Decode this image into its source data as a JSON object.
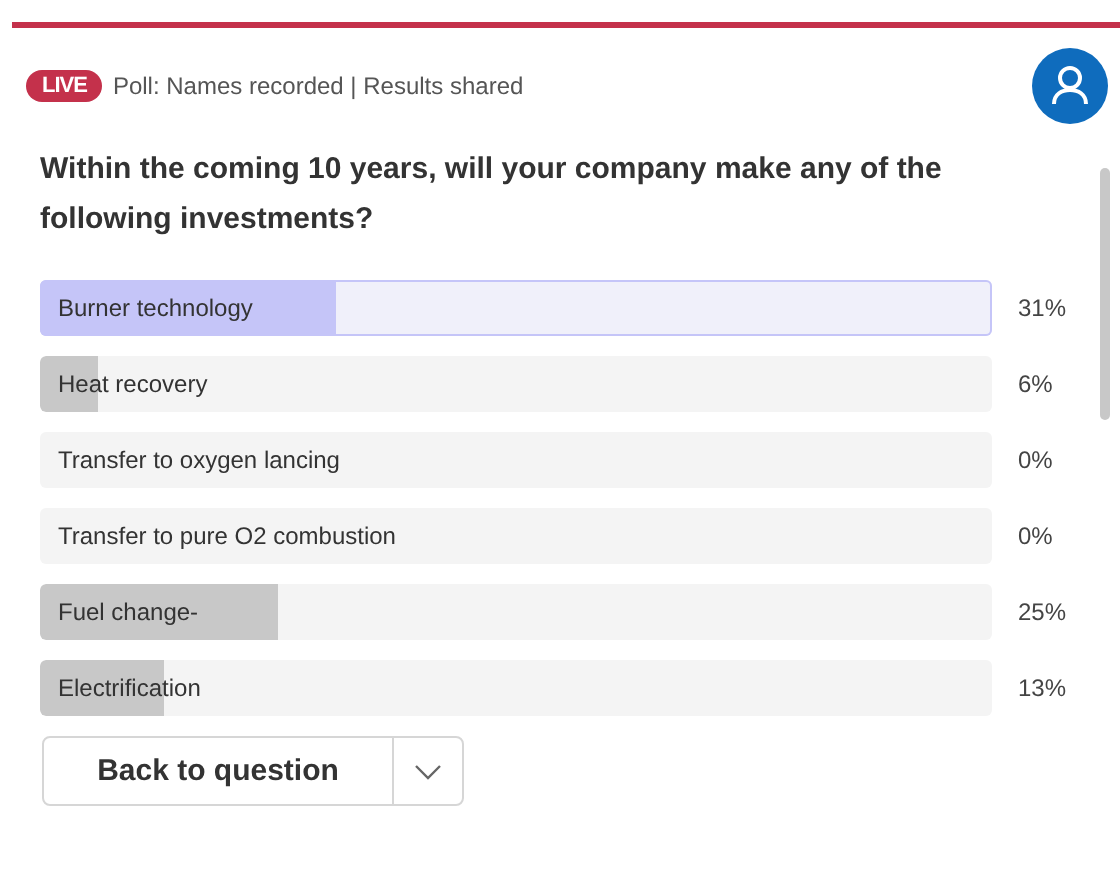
{
  "header": {
    "badge": "LIVE",
    "status": "Poll: Names recorded | Results shared"
  },
  "question": "Within the coming 10 years, will your company make any of the following investments?",
  "options": [
    {
      "label": "Burner technology",
      "level": 0.31,
      "percent": "31%",
      "selected": true
    },
    {
      "label": "Heat recovery",
      "level": 0.06,
      "percent": "6%",
      "selected": false
    },
    {
      "label": "Transfer to oxygen lancing",
      "level": 0,
      "percent": "0%",
      "selected": false
    },
    {
      "label": "Transfer to pure O2 combustion",
      "level": 0,
      "percent": "0%",
      "selected": false
    },
    {
      "label": "Fuel change-",
      "level": 0.25,
      "percent": "25%",
      "selected": false
    },
    {
      "label": "Electrification",
      "level": 0.13,
      "percent": "13%",
      "selected": false
    }
  ],
  "button": {
    "label": "Back to question"
  }
}
